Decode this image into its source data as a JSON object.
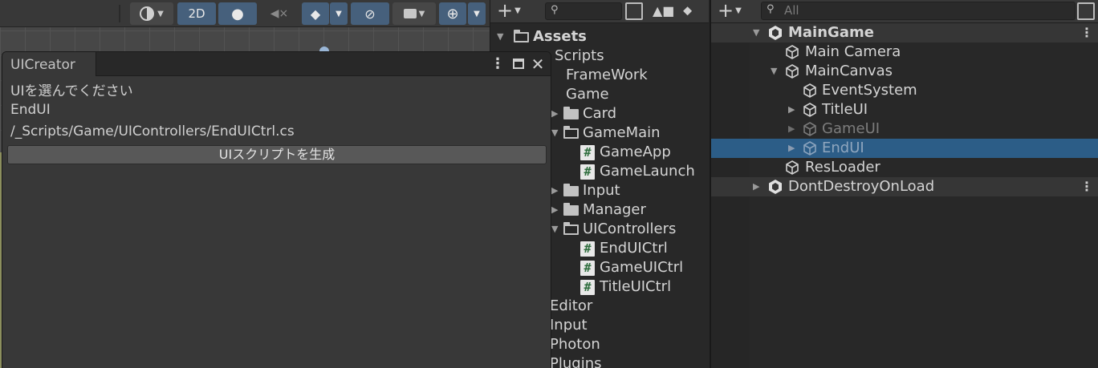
{
  "scene": {
    "toolbar": {
      "mode_2d_label": "2D"
    }
  },
  "uicreator": {
    "tab_title": "UICreator",
    "prompt": "UIを選んでください",
    "selected_ui": "EndUI",
    "script_path": "/_Scripts/Game/UIControllers/EndUICtrl.cs",
    "generate_button": "UIスクリプトを生成"
  },
  "project": {
    "root_label": "Assets",
    "rows": [
      {
        "label": "Scripts"
      },
      {
        "label": "FrameWork"
      },
      {
        "label": "Game"
      },
      {
        "label": "Card"
      },
      {
        "label": "GameMain"
      },
      {
        "label": "GameApp"
      },
      {
        "label": "GameLaunch"
      },
      {
        "label": "Input"
      },
      {
        "label": "Manager"
      },
      {
        "label": "UIControllers"
      },
      {
        "label": "EndUICtrl"
      },
      {
        "label": "GameUICtrl"
      },
      {
        "label": "TitleUICtrl"
      },
      {
        "label": "Editor"
      },
      {
        "label": "Input"
      },
      {
        "label": "Photon"
      },
      {
        "label": "Plugins"
      }
    ]
  },
  "hierarchy": {
    "search_placeholder": "All",
    "rows": [
      {
        "label": "MainGame"
      },
      {
        "label": "Main Camera"
      },
      {
        "label": "MainCanvas"
      },
      {
        "label": "EventSystem"
      },
      {
        "label": "TitleUI"
      },
      {
        "label": "GameUI"
      },
      {
        "label": "EndUI"
      },
      {
        "label": "ResLoader"
      },
      {
        "label": "DontDestroyOnLoad"
      }
    ]
  },
  "colors": {
    "selection": "#2c5d87",
    "active_toggle": "#46607c",
    "csharp_icon_text": "#2f6e3e"
  }
}
